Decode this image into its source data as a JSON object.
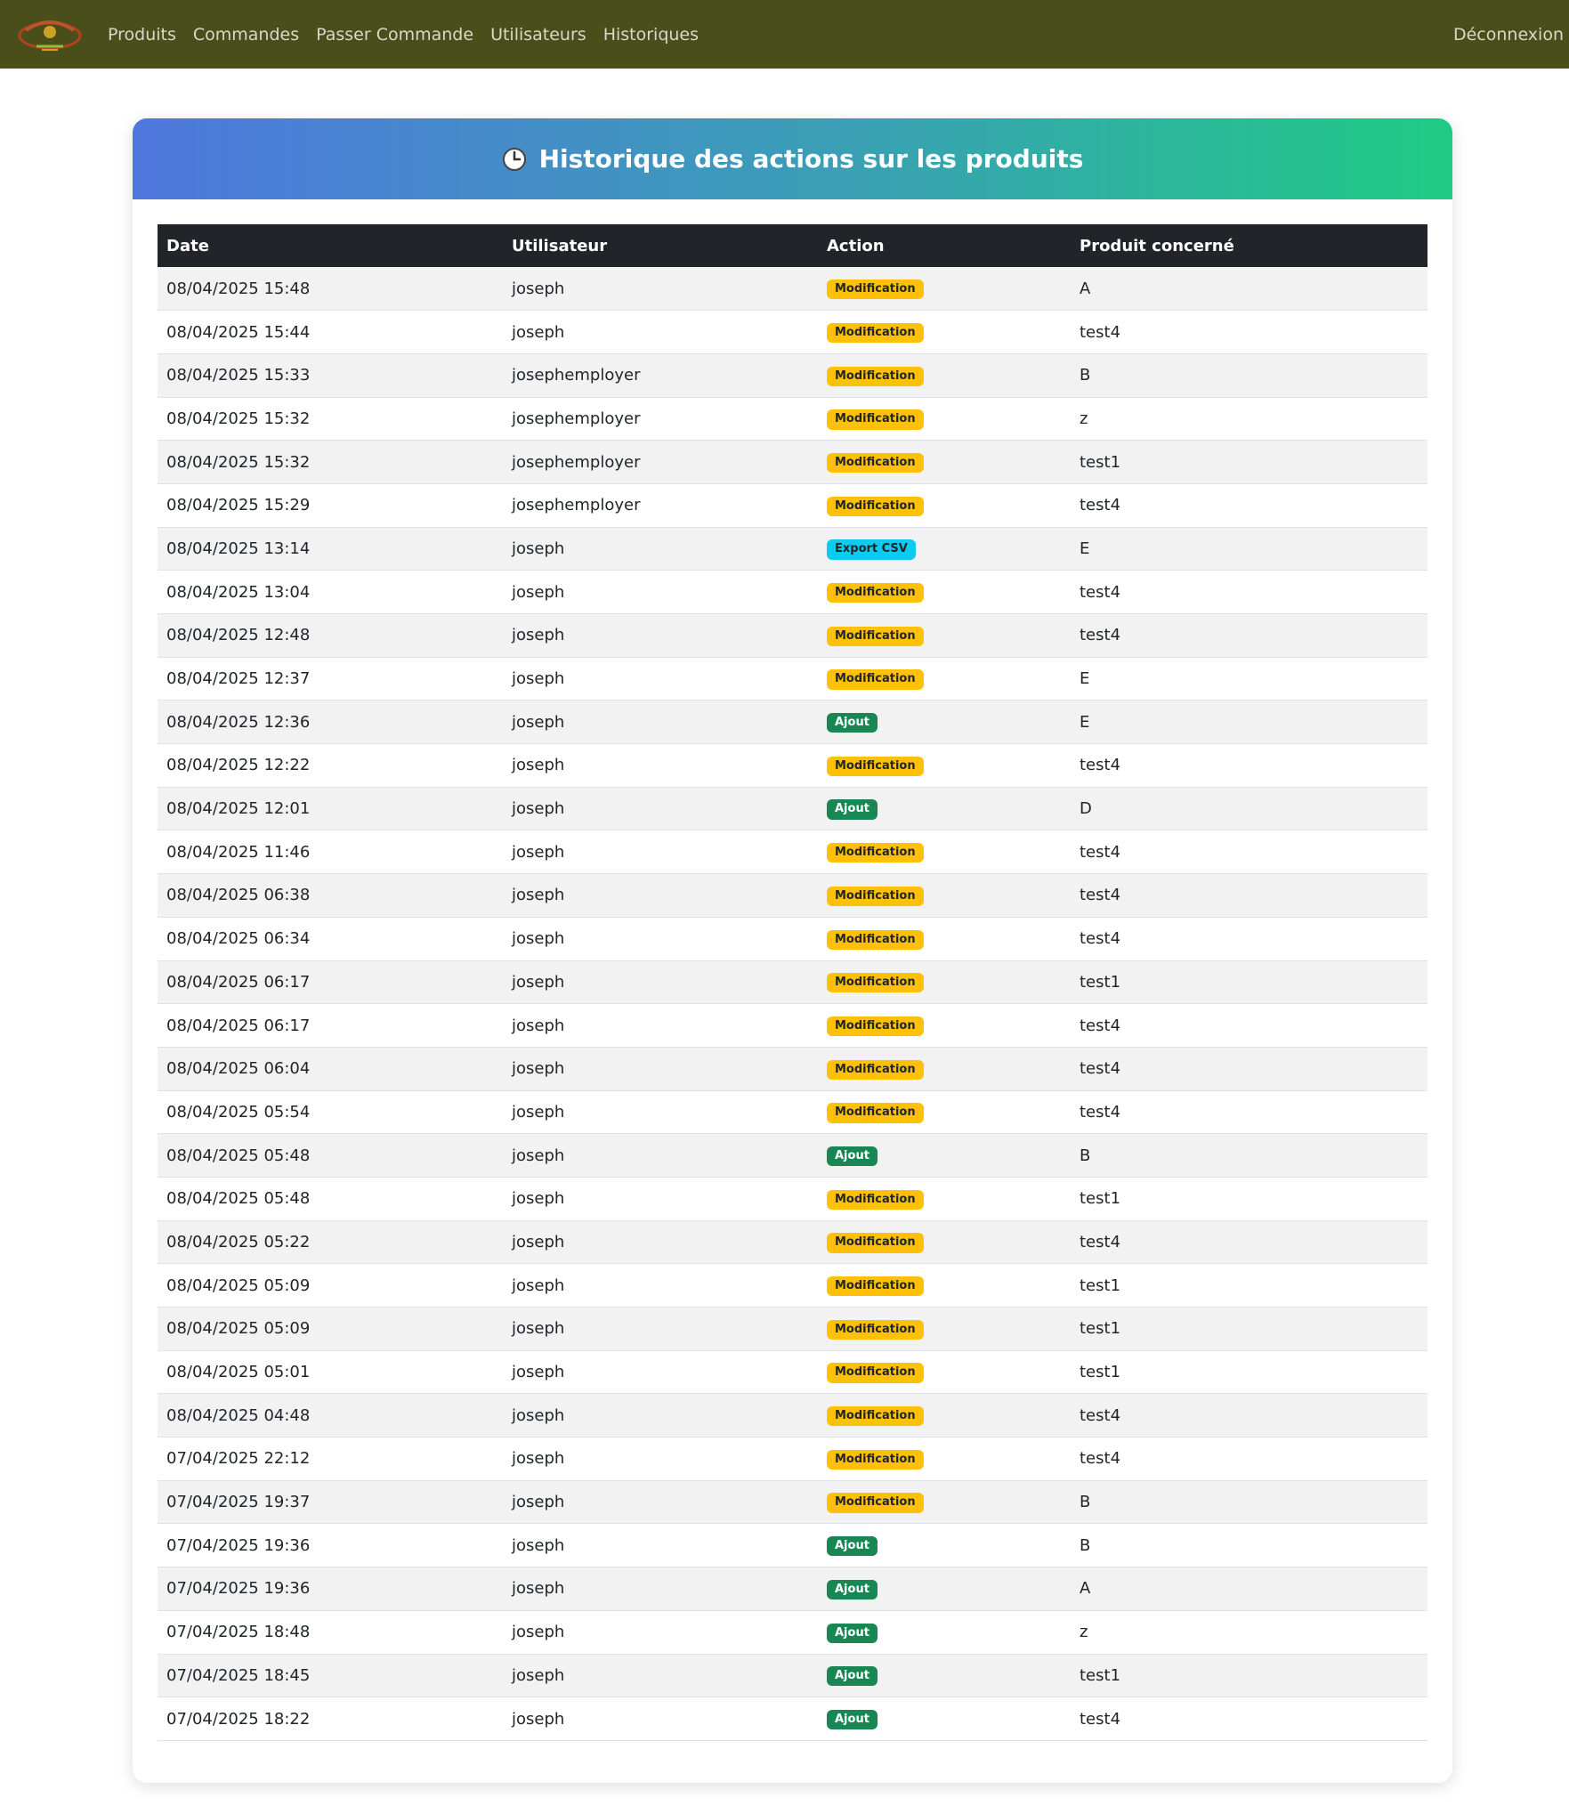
{
  "navbar": {
    "links": [
      "Produits",
      "Commandes",
      "Passer Commande",
      "Utilisateurs",
      "Historiques"
    ],
    "logout": "Déconnexion"
  },
  "card": {
    "title": "Historique des actions sur les produits"
  },
  "table": {
    "headers": [
      "Date",
      "Utilisateur",
      "Action",
      "Produit concerné"
    ],
    "rows": [
      {
        "date": "08/04/2025 15:48",
        "user": "joseph",
        "action": "Modification",
        "type": "modification",
        "product": "A"
      },
      {
        "date": "08/04/2025 15:44",
        "user": "joseph",
        "action": "Modification",
        "type": "modification",
        "product": "test4"
      },
      {
        "date": "08/04/2025 15:33",
        "user": "josephemployer",
        "action": "Modification",
        "type": "modification",
        "product": "B"
      },
      {
        "date": "08/04/2025 15:32",
        "user": "josephemployer",
        "action": "Modification",
        "type": "modification",
        "product": "z"
      },
      {
        "date": "08/04/2025 15:32",
        "user": "josephemployer",
        "action": "Modification",
        "type": "modification",
        "product": "test1"
      },
      {
        "date": "08/04/2025 15:29",
        "user": "josephemployer",
        "action": "Modification",
        "type": "modification",
        "product": "test4"
      },
      {
        "date": "08/04/2025 13:14",
        "user": "joseph",
        "action": "Export CSV",
        "type": "export",
        "product": "E"
      },
      {
        "date": "08/04/2025 13:04",
        "user": "joseph",
        "action": "Modification",
        "type": "modification",
        "product": "test4"
      },
      {
        "date": "08/04/2025 12:48",
        "user": "joseph",
        "action": "Modification",
        "type": "modification",
        "product": "test4"
      },
      {
        "date": "08/04/2025 12:37",
        "user": "joseph",
        "action": "Modification",
        "type": "modification",
        "product": "E"
      },
      {
        "date": "08/04/2025 12:36",
        "user": "joseph",
        "action": "Ajout",
        "type": "ajout",
        "product": "E"
      },
      {
        "date": "08/04/2025 12:22",
        "user": "joseph",
        "action": "Modification",
        "type": "modification",
        "product": "test4"
      },
      {
        "date": "08/04/2025 12:01",
        "user": "joseph",
        "action": "Ajout",
        "type": "ajout",
        "product": "D"
      },
      {
        "date": "08/04/2025 11:46",
        "user": "joseph",
        "action": "Modification",
        "type": "modification",
        "product": "test4"
      },
      {
        "date": "08/04/2025 06:38",
        "user": "joseph",
        "action": "Modification",
        "type": "modification",
        "product": "test4"
      },
      {
        "date": "08/04/2025 06:34",
        "user": "joseph",
        "action": "Modification",
        "type": "modification",
        "product": "test4"
      },
      {
        "date": "08/04/2025 06:17",
        "user": "joseph",
        "action": "Modification",
        "type": "modification",
        "product": "test1"
      },
      {
        "date": "08/04/2025 06:17",
        "user": "joseph",
        "action": "Modification",
        "type": "modification",
        "product": "test4"
      },
      {
        "date": "08/04/2025 06:04",
        "user": "joseph",
        "action": "Modification",
        "type": "modification",
        "product": "test4"
      },
      {
        "date": "08/04/2025 05:54",
        "user": "joseph",
        "action": "Modification",
        "type": "modification",
        "product": "test4"
      },
      {
        "date": "08/04/2025 05:48",
        "user": "joseph",
        "action": "Ajout",
        "type": "ajout",
        "product": "B"
      },
      {
        "date": "08/04/2025 05:48",
        "user": "joseph",
        "action": "Modification",
        "type": "modification",
        "product": "test1"
      },
      {
        "date": "08/04/2025 05:22",
        "user": "joseph",
        "action": "Modification",
        "type": "modification",
        "product": "test4"
      },
      {
        "date": "08/04/2025 05:09",
        "user": "joseph",
        "action": "Modification",
        "type": "modification",
        "product": "test1"
      },
      {
        "date": "08/04/2025 05:09",
        "user": "joseph",
        "action": "Modification",
        "type": "modification",
        "product": "test1"
      },
      {
        "date": "08/04/2025 05:01",
        "user": "joseph",
        "action": "Modification",
        "type": "modification",
        "product": "test1"
      },
      {
        "date": "08/04/2025 04:48",
        "user": "joseph",
        "action": "Modification",
        "type": "modification",
        "product": "test4"
      },
      {
        "date": "07/04/2025 22:12",
        "user": "joseph",
        "action": "Modification",
        "type": "modification",
        "product": "test4"
      },
      {
        "date": "07/04/2025 19:37",
        "user": "joseph",
        "action": "Modification",
        "type": "modification",
        "product": "B"
      },
      {
        "date": "07/04/2025 19:36",
        "user": "joseph",
        "action": "Ajout",
        "type": "ajout",
        "product": "B"
      },
      {
        "date": "07/04/2025 19:36",
        "user": "joseph",
        "action": "Ajout",
        "type": "ajout",
        "product": "A"
      },
      {
        "date": "07/04/2025 18:48",
        "user": "joseph",
        "action": "Ajout",
        "type": "ajout",
        "product": "z"
      },
      {
        "date": "07/04/2025 18:45",
        "user": "joseph",
        "action": "Ajout",
        "type": "ajout",
        "product": "test1"
      },
      {
        "date": "07/04/2025 18:22",
        "user": "joseph",
        "action": "Ajout",
        "type": "ajout",
        "product": "test4"
      }
    ]
  },
  "icons": {
    "logo": "brand-logo",
    "title_icon": "clock-icon"
  },
  "colors": {
    "navbar": "#4a4e1a",
    "header_start": "#4f77de",
    "header_end": "#1fcb84",
    "table_head": "#212529",
    "badge_modification": "#ffc107",
    "badge_ajout": "#198754",
    "badge_export": "#0dcaf0"
  }
}
